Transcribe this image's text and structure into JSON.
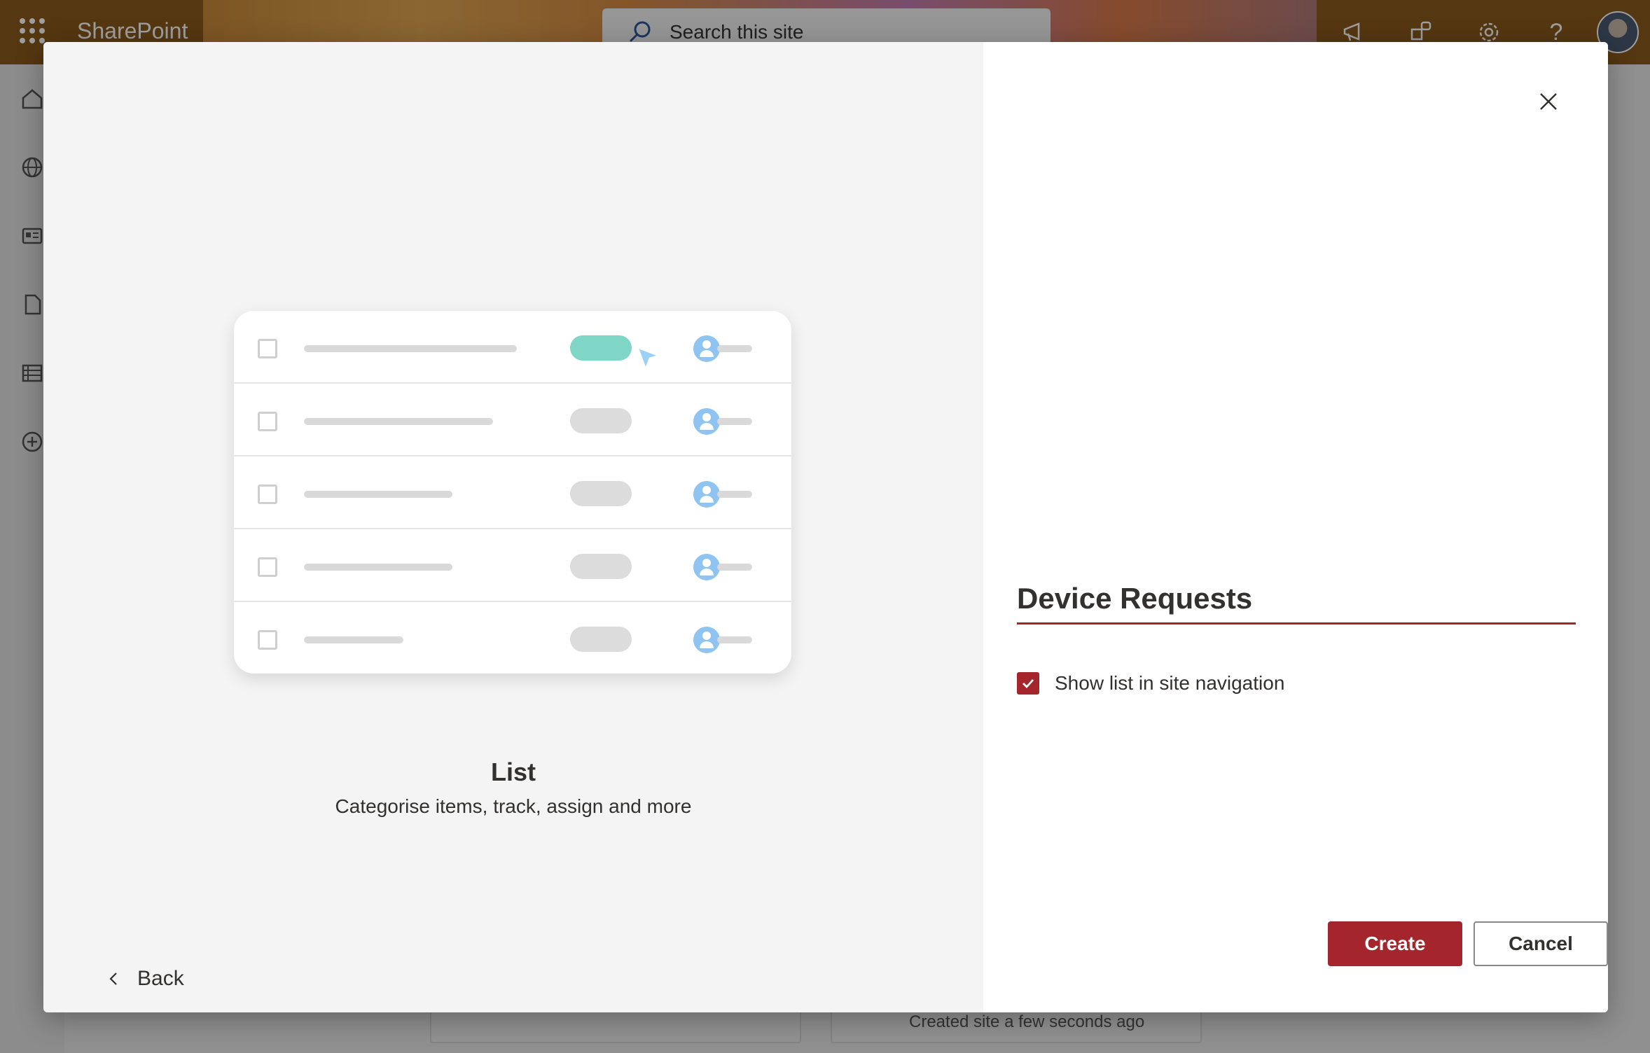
{
  "suite_bar": {
    "brand": "SharePoint",
    "search_placeholder": "Search this site",
    "icons": [
      "waffle-icon",
      "megaphone-icon",
      "share-icon",
      "settings-icon",
      "help-icon"
    ]
  },
  "left_rail": {
    "icons": [
      "home-icon",
      "globe-icon",
      "news-icon",
      "document-icon",
      "list-icon",
      "add-icon"
    ]
  },
  "background": {
    "activity_text": "Created site a few seconds ago"
  },
  "dialog": {
    "template": {
      "title": "List",
      "description": "Categorise items, track, assign and more",
      "illustration_rows": 5,
      "active_row": 1
    },
    "back_label": "Back",
    "name_value": "Device Requests",
    "show_in_nav_label": "Show list in site navigation",
    "show_in_nav_checked": true,
    "create_label": "Create",
    "cancel_label": "Cancel",
    "accent_color": "#a4262c"
  }
}
